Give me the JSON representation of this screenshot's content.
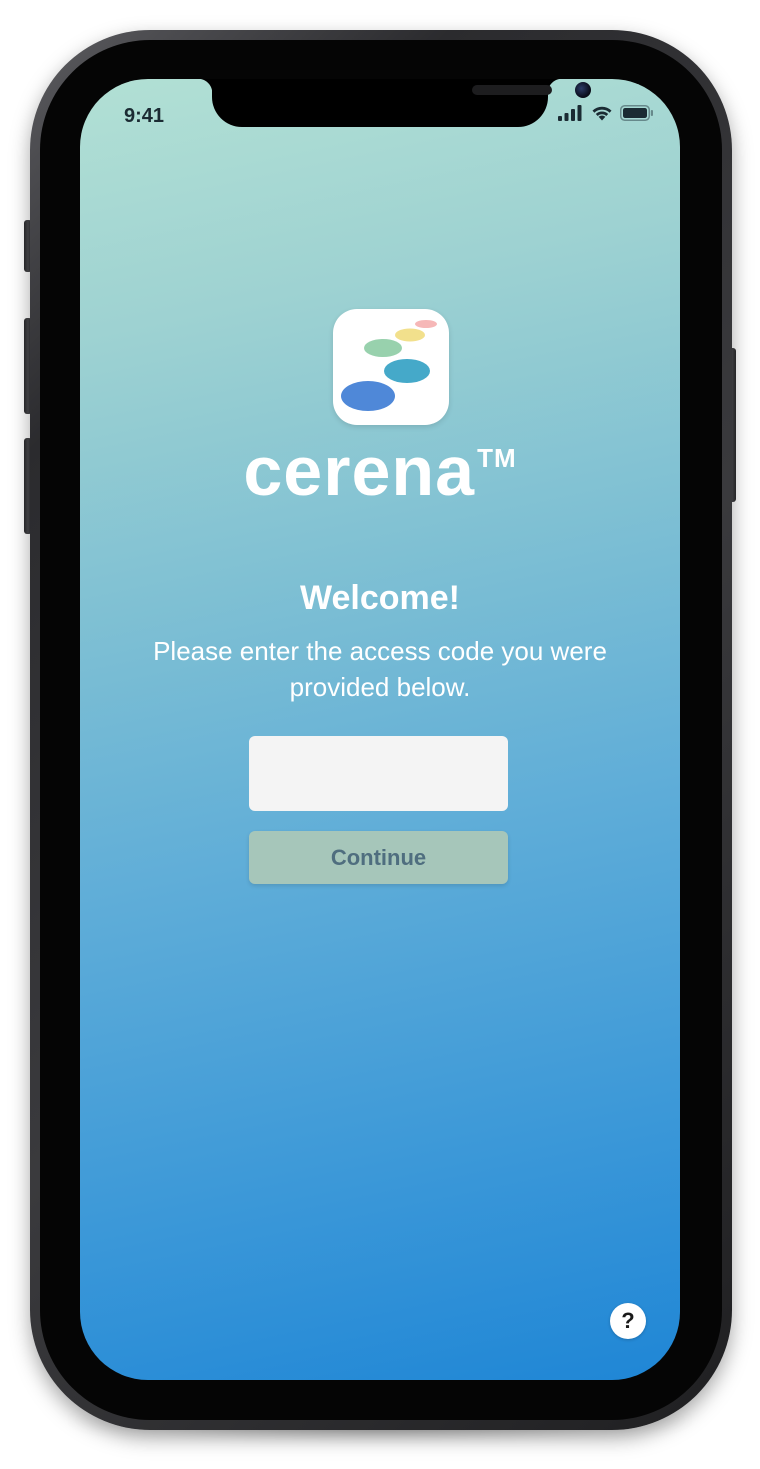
{
  "status_bar": {
    "time": "9:41",
    "icons": [
      "cellular-signal-icon",
      "wifi-icon",
      "battery-icon"
    ]
  },
  "app": {
    "logo_icon": "cerena-app-icon",
    "wordmark": "cerena",
    "trademark": "TM",
    "logo_colors": [
      "#4f88d8",
      "#45a9c9",
      "#98d1ad",
      "#f2e08c",
      "#f6b7b7"
    ]
  },
  "welcome": {
    "title": "Welcome!",
    "instructions": "Please enter the access code you were provided below."
  },
  "access_code": {
    "value": "",
    "placeholder": ""
  },
  "buttons": {
    "continue_label": "Continue",
    "help_label": "?"
  },
  "colors": {
    "gradient_top": "#b2e0d4",
    "gradient_bottom": "#1f86d6",
    "continue_bg": "#a6c6ba",
    "continue_text": "#4f6e7f"
  }
}
